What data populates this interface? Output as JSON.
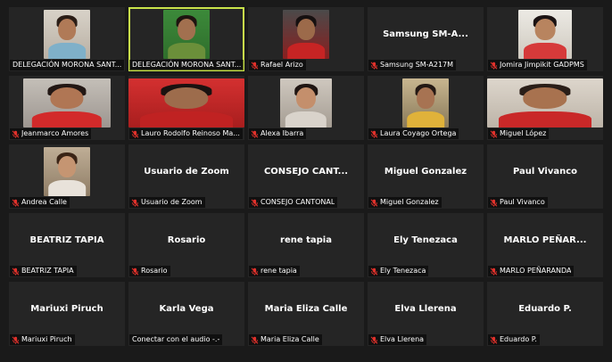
{
  "colors": {
    "background": "#1a1a1a",
    "tile": "#252525",
    "active_speaker": "#c9e34a",
    "muted_icon": "#e0312b"
  },
  "icons": {
    "muted": "muted-microphone-icon"
  },
  "participants": [
    {
      "label": "DELEGACIÓN MORONA SANT...",
      "muted": false,
      "video": true,
      "active": false
    },
    {
      "label": "DELEGACIÓN MORONA SANT...",
      "muted": false,
      "video": true,
      "active": true
    },
    {
      "label": "Rafael Arizo",
      "muted": true,
      "video": true,
      "active": false
    },
    {
      "label": "Samsung SM-A217M",
      "muted": true,
      "video": false,
      "display_name": "Samsung  SM-A...",
      "active": false
    },
    {
      "label": "Jomira Jimpikit GADPMS",
      "muted": true,
      "video": true,
      "active": false
    },
    {
      "label": "Jeanmarco Amores",
      "muted": true,
      "video": true,
      "active": false
    },
    {
      "label": "Lauro Rodolfo Reinoso Ma...",
      "muted": true,
      "video": true,
      "active": false
    },
    {
      "label": "Alexa Ibarra",
      "muted": true,
      "video": true,
      "active": false
    },
    {
      "label": "Laura Coyago Ortega",
      "muted": true,
      "video": true,
      "active": false
    },
    {
      "label": "Miguel López",
      "muted": true,
      "video": true,
      "active": false
    },
    {
      "label": "Andrea Calle",
      "muted": true,
      "video": true,
      "active": false
    },
    {
      "label": "Usuario de Zoom",
      "muted": true,
      "video": false,
      "display_name": "Usuario de Zoom",
      "active": false
    },
    {
      "label": "CONSEJO CANTONAL",
      "muted": true,
      "video": false,
      "display_name": "CONSEJO  CANT...",
      "active": false
    },
    {
      "label": "Miguel Gonzalez",
      "muted": true,
      "video": false,
      "display_name": "Miguel Gonzalez",
      "active": false
    },
    {
      "label": "Paul Vivanco",
      "muted": true,
      "video": false,
      "display_name": "Paul Vivanco",
      "active": false
    },
    {
      "label": "BEATRIZ TAPIA",
      "muted": true,
      "video": false,
      "display_name": "BEATRIZ TAPIA",
      "active": false
    },
    {
      "label": "Rosario",
      "muted": true,
      "video": false,
      "display_name": "Rosario",
      "active": false
    },
    {
      "label": "rene tapia",
      "muted": true,
      "video": false,
      "display_name": "rene tapia",
      "active": false
    },
    {
      "label": "Ely Tenezaca",
      "muted": true,
      "video": false,
      "display_name": "Ely Tenezaca",
      "active": false
    },
    {
      "label": "MARLO PEÑARANDA",
      "muted": true,
      "video": false,
      "display_name": "MARLO  PEÑAR...",
      "active": false
    },
    {
      "label": "Mariuxi Piruch",
      "muted": true,
      "video": false,
      "display_name": "Mariuxi Piruch",
      "active": false
    },
    {
      "label": "Conectar con el audio -.-",
      "muted": false,
      "video": false,
      "display_name": "Karla Vega",
      "active": false
    },
    {
      "label": "Maria Eliza Calle",
      "muted": true,
      "video": false,
      "display_name": "Maria Eliza Calle",
      "active": false
    },
    {
      "label": "Elva Llerena",
      "muted": true,
      "video": false,
      "display_name": "Elva Llerena",
      "active": false
    },
    {
      "label": "Eduardo P.",
      "muted": true,
      "video": false,
      "display_name": "Eduardo P.",
      "active": false
    }
  ]
}
